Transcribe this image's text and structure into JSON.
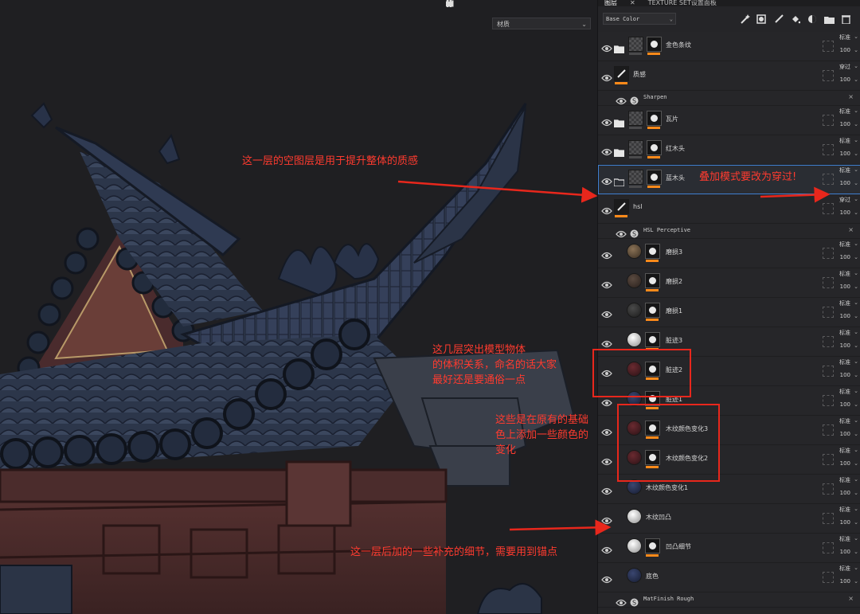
{
  "viewport": {
    "toolbar_icons": [
      "pause-icon",
      "view-cube-icon",
      "camera-icon",
      "screenshot-icon"
    ],
    "material_select": "材质"
  },
  "annotations": {
    "top": "这一层的空图层是用于提升整体的质感",
    "blend_mode": "叠加模式要改为穿过!",
    "volume_l1": "这几层突出模型物体",
    "volume_l2": "的体积关系，命名的话大家",
    "volume_l3": "最好还是要通俗一点",
    "color_l1": "这些是在原有的基础",
    "color_l2": "色上添加一些颜色的",
    "color_l3": "变化",
    "bottom": "这一层后加的一些补充的细节，需要用到锚点"
  },
  "panel": {
    "tabs": [
      "图层",
      "TEXTURE SET设置面板"
    ],
    "channel": "Base Color",
    "toolbar_icons": [
      "magic-wand-icon",
      "fill-layer-icon",
      "paint-brush-icon",
      "fill-bucket-icon",
      "mask-icon",
      "folder-icon",
      "trash-icon"
    ],
    "layers": [
      {
        "kind": "folder",
        "name": "金色条纹",
        "blend": "标准",
        "opacity": "100",
        "thumb": "folder"
      },
      {
        "kind": "paint",
        "name": "质感",
        "blend": "穿过",
        "opacity": "100",
        "thumb": "paint"
      },
      {
        "kind": "effect",
        "name": "Sharpen"
      },
      {
        "kind": "folder",
        "name": "瓦片",
        "blend": "标准",
        "opacity": "100",
        "thumb": "folder"
      },
      {
        "kind": "folder",
        "name": "红木头",
        "blend": "标准",
        "opacity": "100",
        "thumb": "folder"
      },
      {
        "kind": "folder-open",
        "name": "蓝木头",
        "blend": "标准",
        "opacity": "100",
        "thumb": "folder",
        "selected": true
      },
      {
        "kind": "paint",
        "name": "hsl",
        "blend": "穿过",
        "opacity": "100",
        "thumb": "paint"
      },
      {
        "kind": "effect",
        "name": "HSL Perceptive"
      },
      {
        "kind": "fill",
        "name": "磨损3",
        "blend": "标准",
        "opacity": "100",
        "thumb": "brown"
      },
      {
        "kind": "fill",
        "name": "磨损2",
        "blend": "标准",
        "opacity": "100",
        "thumb": "darkbrown"
      },
      {
        "kind": "fill",
        "name": "磨损1",
        "blend": "标准",
        "opacity": "100",
        "thumb": "dark"
      },
      {
        "kind": "fill",
        "name": "脏迹3",
        "blend": "标准",
        "opacity": "100",
        "thumb": "white"
      },
      {
        "kind": "fill",
        "name": "脏迹2",
        "blend": "标准",
        "opacity": "100",
        "thumb": "maroon"
      },
      {
        "kind": "fill",
        "name": "脏迹1",
        "blend": "标准",
        "opacity": "100",
        "thumb": "navy"
      },
      {
        "kind": "fill",
        "name": "木纹颜色变化3",
        "blend": "标准",
        "opacity": "100",
        "thumb": "maroon"
      },
      {
        "kind": "fill",
        "name": "木纹颜色变化2",
        "blend": "标准",
        "opacity": "100",
        "thumb": "maroon"
      },
      {
        "kind": "fill-nomask",
        "name": "木纹颜色变化1",
        "blend": "标准",
        "opacity": "100",
        "thumb": "navy"
      },
      {
        "kind": "fill-nomask",
        "name": "木纹凹凸",
        "blend": "标准",
        "opacity": "100",
        "thumb": "white"
      },
      {
        "kind": "fill",
        "name": "凹凸细节",
        "blend": "标准",
        "opacity": "100",
        "thumb": "white"
      },
      {
        "kind": "fill-nomask",
        "name": "底色",
        "blend": "标准",
        "opacity": "100",
        "thumb": "navy"
      },
      {
        "kind": "effect",
        "name": "MatFinish Rough"
      }
    ]
  },
  "colors": {
    "accent": "#ff8a1a",
    "annotation": "#ff3b2f",
    "selection": "#3f7fd0"
  }
}
